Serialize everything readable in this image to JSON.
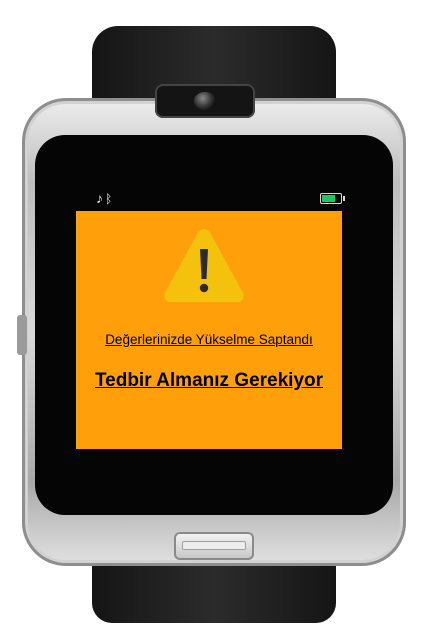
{
  "status_bar": {
    "music_icon": "music-note-icon",
    "bluetooth_icon": "bluetooth-icon",
    "battery_icon": "battery-icon",
    "battery_level": 0.75,
    "battery_color": "#22c55e"
  },
  "alert": {
    "icon": "warning-triangle-icon",
    "icon_color": "#f4c20d",
    "background_color": "#ff9f0a",
    "line1": "Değerlerinizde Yükselme Saptandı",
    "line2": "Tedbir Almanız Gerekiyor"
  }
}
